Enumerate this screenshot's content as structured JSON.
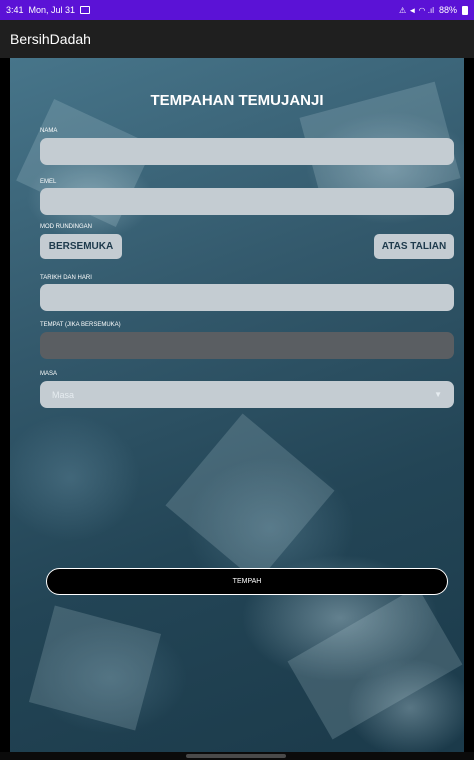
{
  "status_bar": {
    "time": "3:41",
    "date": "Mon, Jul 31",
    "indicators": "⚠ ◄ ◠ .ıl",
    "battery": "88%"
  },
  "app": {
    "title": "BersihDadah"
  },
  "form": {
    "title": "TEMPAHAN TEMUJANJI",
    "name_label": "NAMA",
    "email_label": "EMEL",
    "mode_label": "MOD RUNDINGAN",
    "mode_options": [
      "BERSEMUKA",
      "ATAS TALIAN"
    ],
    "date_label": "TARIKH DAN HARI",
    "place_label": "TEMPAT (JIKA BERSEMUKA)",
    "time_label": "MASA",
    "time_placeholder": "Masa",
    "submit_label": "TEMPAH"
  },
  "colors": {
    "status_bar": "#5b12d6",
    "app_bar": "#1f1f1f",
    "field_bg": "#c4ccd2",
    "field_disabled_bg": "#5a5e62",
    "button_text": "#1e3a4c"
  }
}
